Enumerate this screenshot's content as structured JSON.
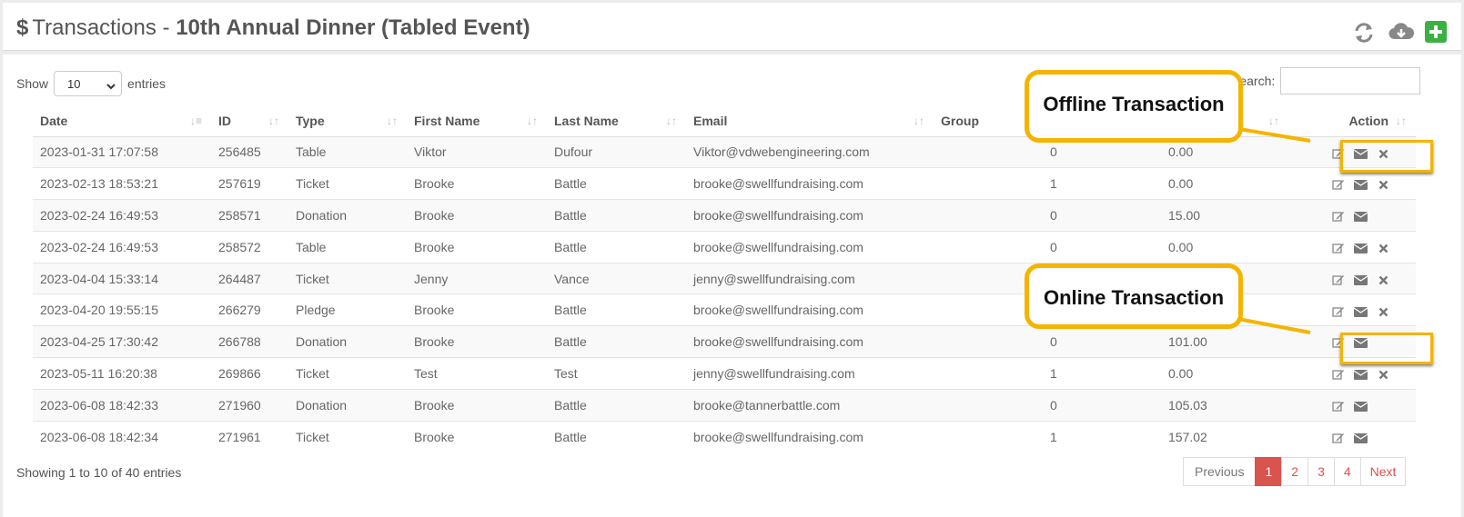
{
  "header": {
    "dollar": "$",
    "title_prefix": "Transactions - ",
    "event_name": "10th Annual Dinner (Tabled Event)",
    "icons": [
      "refresh-icon",
      "cloud-download-icon",
      "add-icon"
    ]
  },
  "controls": {
    "show_label": "Show",
    "entries_label": "entries",
    "entries_value": "10",
    "search_label": "Search:"
  },
  "table": {
    "columns": [
      "Date",
      "ID",
      "Type",
      "First Name",
      "Last Name",
      "Email",
      "Group",
      "",
      "",
      "Action"
    ],
    "rows": [
      {
        "date": "2023-01-31 17:07:58",
        "id": "256485",
        "type": "Table",
        "first": "Viktor",
        "last": "Dufour",
        "email": "Viktor@vdwebengineering.com",
        "qty": "0",
        "amount": "0.00",
        "deletable": true
      },
      {
        "date": "2023-02-13 18:53:21",
        "id": "257619",
        "type": "Ticket",
        "first": "Brooke",
        "last": "Battle",
        "email": "brooke@swellfundraising.com",
        "qty": "1",
        "amount": "0.00",
        "deletable": true
      },
      {
        "date": "2023-02-24 16:49:53",
        "id": "258571",
        "type": "Donation",
        "first": "Brooke",
        "last": "Battle",
        "email": "brooke@swellfundraising.com",
        "qty": "0",
        "amount": "15.00",
        "deletable": false
      },
      {
        "date": "2023-02-24 16:49:53",
        "id": "258572",
        "type": "Table",
        "first": "Brooke",
        "last": "Battle",
        "email": "brooke@swellfundraising.com",
        "qty": "0",
        "amount": "0.00",
        "deletable": true
      },
      {
        "date": "2023-04-04 15:33:14",
        "id": "264487",
        "type": "Ticket",
        "first": "Jenny",
        "last": "Vance",
        "email": "jenny@swellfundraising.com",
        "qty": "",
        "amount": "",
        "deletable": true
      },
      {
        "date": "2023-04-20 19:55:15",
        "id": "266279",
        "type": "Pledge",
        "first": "Brooke",
        "last": "Battle",
        "email": "brooke@swellfundraising.com",
        "qty": "",
        "amount": "",
        "deletable": true
      },
      {
        "date": "2023-04-25 17:30:42",
        "id": "266788",
        "type": "Donation",
        "first": "Brooke",
        "last": "Battle",
        "email": "brooke@swellfundraising.com",
        "qty": "0",
        "amount": "101.00",
        "deletable": false
      },
      {
        "date": "2023-05-11 16:20:38",
        "id": "269866",
        "type": "Ticket",
        "first": "Test",
        "last": "Test",
        "email": "jenny@swellfundraising.com",
        "qty": "1",
        "amount": "0.00",
        "deletable": true
      },
      {
        "date": "2023-06-08 18:42:33",
        "id": "271960",
        "type": "Donation",
        "first": "Brooke",
        "last": "Battle",
        "email": "brooke@tannerbattle.com",
        "qty": "0",
        "amount": "105.03",
        "deletable": false
      },
      {
        "date": "2023-06-08 18:42:34",
        "id": "271961",
        "type": "Ticket",
        "first": "Brooke",
        "last": "Battle",
        "email": "brooke@swellfundraising.com",
        "qty": "1",
        "amount": "157.02",
        "deletable": false
      }
    ]
  },
  "footer": {
    "info": "Showing 1 to 10 of 40 entries",
    "pagination": [
      "Previous",
      "1",
      "2",
      "3",
      "4",
      "Next"
    ],
    "active_page": "1"
  },
  "annotations": {
    "offline": "Offline Transaction",
    "online": "Online Transaction"
  },
  "colors": {
    "accent_red": "#d9534f",
    "highlight_yellow": "#f4b400",
    "add_green": "#3cb043"
  }
}
